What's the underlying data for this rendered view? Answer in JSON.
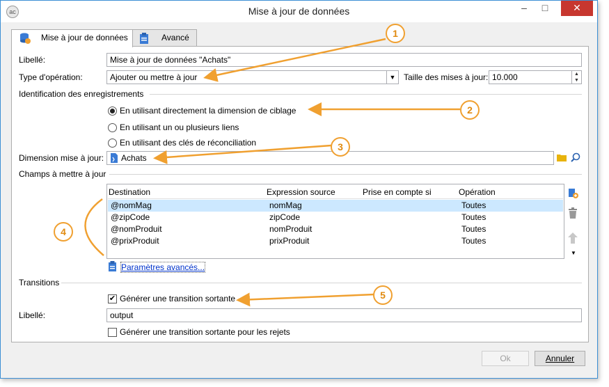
{
  "window": {
    "title": "Mise à jour de données",
    "app_icon": "ac",
    "minimize": "–",
    "maximize": "□",
    "close": "✕"
  },
  "tabs": [
    {
      "label": "Mise à jour de données",
      "icon": "database-update-icon"
    },
    {
      "label": "Avancé",
      "icon": "clipboard-icon"
    }
  ],
  "form": {
    "libelle_label": "Libellé:",
    "libelle_value": "Mise à jour de données \"Achats\"",
    "type_label": "Type d'opération:",
    "type_value": "Ajouter ou mettre à jour",
    "taille_label": "Taille des mises à jour:",
    "taille_value": "10.000",
    "identification_title": "Identification des enregistrements",
    "radio1": "En utilisant directement la dimension de ciblage",
    "radio2": "En utilisant un ou plusieurs liens",
    "radio3": "En utilisant des clés de réconciliation",
    "dimension_label": "Dimension mise à jour:",
    "dimension_value": "Achats",
    "champs_title": "Champs à mettre à jour",
    "advanced_link": "Paramètres avancés...",
    "transitions_title": "Transitions",
    "gen_transition": "Générer une transition sortante",
    "libelle2_label": "Libellé:",
    "libelle2_value": "output",
    "gen_rejets": "Générer une transition sortante pour les rejets"
  },
  "grid": {
    "columns": [
      "Destination",
      "Expression source",
      "Prise en compte si",
      "Opération"
    ],
    "rows": [
      [
        "@nomMag",
        "nomMag",
        "",
        "Toutes"
      ],
      [
        "@zipCode",
        "zipCode",
        "",
        "Toutes"
      ],
      [
        "@nomProduit",
        "nomProduit",
        "",
        "Toutes"
      ],
      [
        "@prixProduit",
        "prixProduit",
        "",
        "Toutes"
      ]
    ]
  },
  "buttons": {
    "ok": "Ok",
    "cancel": "Annuler"
  },
  "callouts": [
    "1",
    "2",
    "3",
    "4",
    "5"
  ],
  "colors": {
    "accent": "#f0a030",
    "selection": "#cce8ff",
    "link": "#0033cc"
  }
}
